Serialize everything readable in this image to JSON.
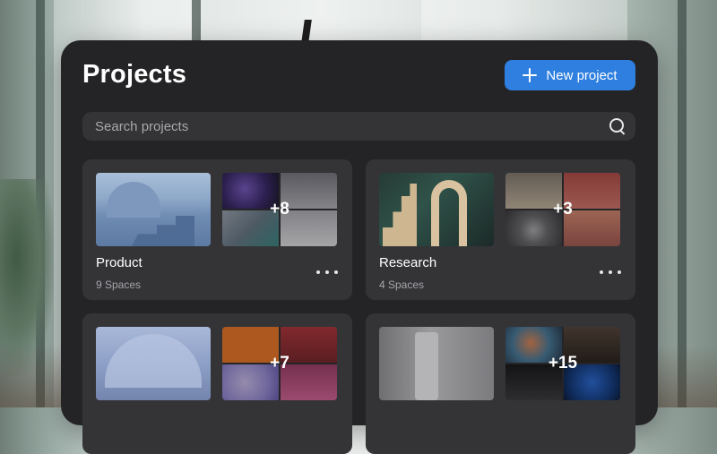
{
  "header": {
    "title": "Projects",
    "new_project_label": "New project"
  },
  "search": {
    "placeholder": "Search projects",
    "value": ""
  },
  "projects": [
    {
      "name": "Product",
      "spaces": "9 Spaces",
      "more_count": "+8"
    },
    {
      "name": "Research",
      "spaces": "4 Spaces",
      "more_count": "+3"
    },
    {
      "name": "",
      "spaces": "",
      "more_count": "+7"
    },
    {
      "name": "",
      "spaces": "",
      "more_count": "+15"
    }
  ],
  "icons": {
    "new_project": "plus-icon",
    "search": "search-icon",
    "more": "more-options-icon"
  },
  "colors": {
    "panel": "#242426",
    "card": "#343437",
    "accent": "#2f7fe0",
    "text": "#ffffff",
    "muted": "#a6a6aa"
  }
}
